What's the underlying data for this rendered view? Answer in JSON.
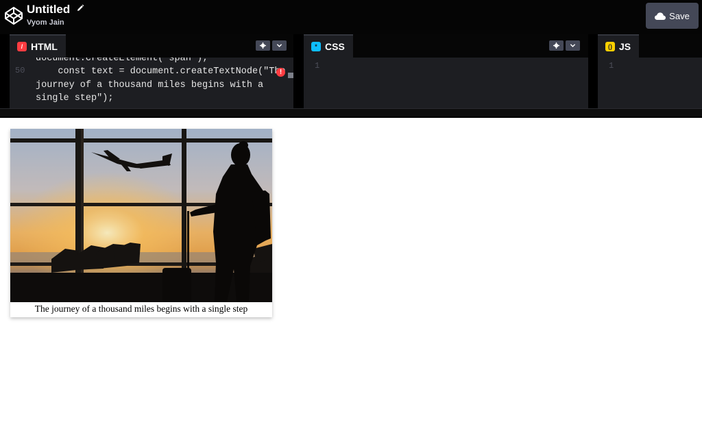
{
  "header": {
    "title": "Untitled",
    "author": "Vyom Jain",
    "save_label": "Save"
  },
  "editors": {
    "html": {
      "tab_label": "HTML",
      "badge_glyph": "/",
      "line_numbers": [
        "50"
      ],
      "code_lines": [
        "document.createElement(\"span\");",
        "    const text = document.createTextNode(\"The",
        "journey of a thousand miles begins with a",
        "single step\");"
      ]
    },
    "css": {
      "tab_label": "CSS",
      "badge_glyph": "*",
      "line_numbers": [
        "1"
      ]
    },
    "js": {
      "tab_label": "JS",
      "badge_glyph": "()",
      "line_numbers": [
        "1"
      ]
    }
  },
  "preview": {
    "caption": "The journey of a thousand miles begins with a single step"
  },
  "icons": {
    "logo": "codepen-logo-icon",
    "edit": "pencil-icon",
    "save": "cloud-icon",
    "settings": "gear-icon",
    "collapse": "chevron-down-icon",
    "error": "error-icon"
  },
  "colors": {
    "header_bg": "#050505",
    "editor_bg": "#1d1e22",
    "button_bg": "#444857",
    "html_badge": "#ff3c41",
    "css_badge": "#0ebeff",
    "js_badge": "#fcd000"
  }
}
